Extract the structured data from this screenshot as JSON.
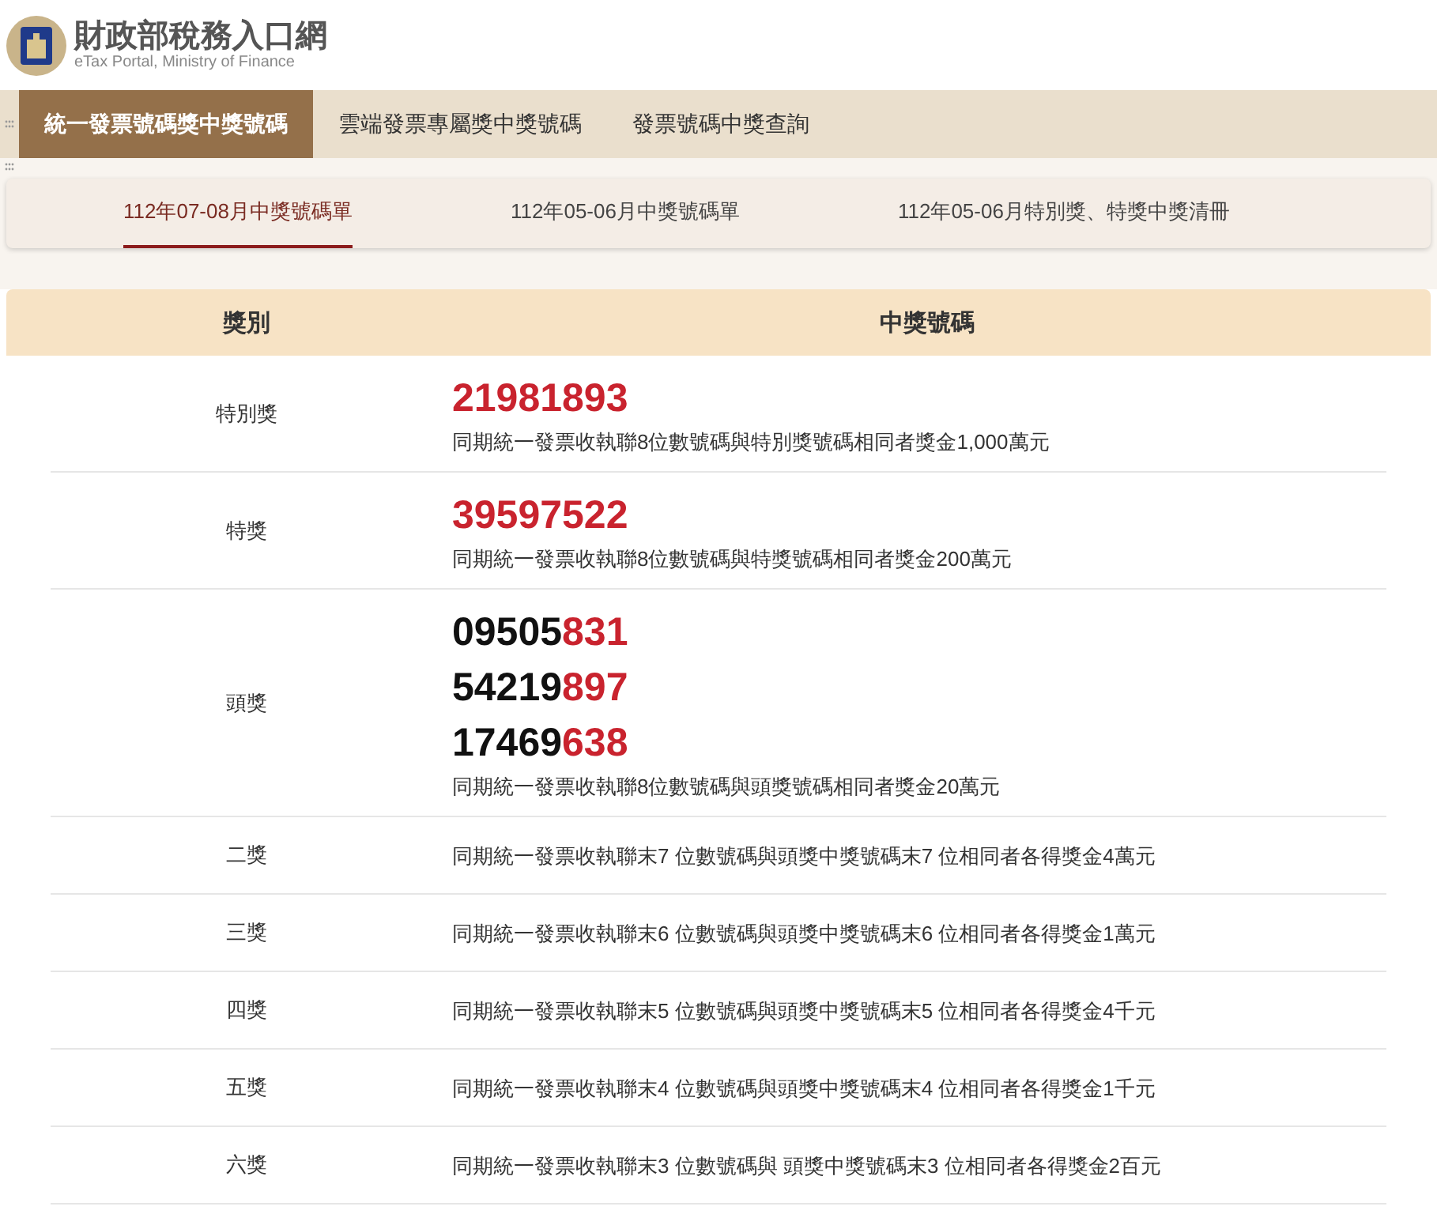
{
  "header": {
    "title": "財政部稅務入口網",
    "subtitle": "eTax Portal, Ministry of Finance"
  },
  "nav_tabs": [
    {
      "label": "統一發票號碼獎中獎號碼",
      "selected": true
    },
    {
      "label": "雲端發票專屬獎中獎號碼",
      "selected": false
    },
    {
      "label": "發票號碼中獎查詢",
      "selected": false
    }
  ],
  "period_tabs": [
    {
      "label": "112年07-08月中獎號碼單",
      "selected": true
    },
    {
      "label": "112年05-06月中獎號碼單",
      "selected": false
    },
    {
      "label": "112年05-06月特別獎、特獎中獎清冊",
      "selected": false
    }
  ],
  "table": {
    "columns": [
      "獎別",
      "中獎號碼"
    ],
    "rows": [
      {
        "prize": "特別獎",
        "numbers": [
          {
            "red": "21981893"
          }
        ],
        "description": "同期統一發票收執聯8位數號碼與特別獎號碼相同者獎金1,000萬元"
      },
      {
        "prize": "特獎",
        "numbers": [
          {
            "red": "39597522"
          }
        ],
        "description": "同期統一發票收執聯8位數號碼與特獎號碼相同者獎金200萬元"
      },
      {
        "prize": "頭獎",
        "numbers": [
          {
            "plain": "09505",
            "red": "831"
          },
          {
            "plain": "54219",
            "red": "897"
          },
          {
            "plain": "17469",
            "red": "638"
          }
        ],
        "description": "同期統一發票收執聯8位數號碼與頭獎號碼相同者獎金20萬元"
      },
      {
        "prize": "二獎",
        "description": "同期統一發票收執聯末7 位數號碼與頭獎中獎號碼末7 位相同者各得獎金4萬元"
      },
      {
        "prize": "三獎",
        "description": "同期統一發票收執聯末6 位數號碼與頭獎中獎號碼末6 位相同者各得獎金1萬元"
      },
      {
        "prize": "四獎",
        "description": "同期統一發票收執聯末5 位數號碼與頭獎中獎號碼末5 位相同者各得獎金4千元"
      },
      {
        "prize": "五獎",
        "description": "同期統一發票收執聯末4 位數號碼與頭獎中獎號碼末4 位相同者各得獎金1千元"
      },
      {
        "prize": "六獎",
        "description": "同期統一發票收執聯末3 位數號碼與 頭獎中獎號碼末3 位相同者各得獎金2百元"
      }
    ]
  }
}
